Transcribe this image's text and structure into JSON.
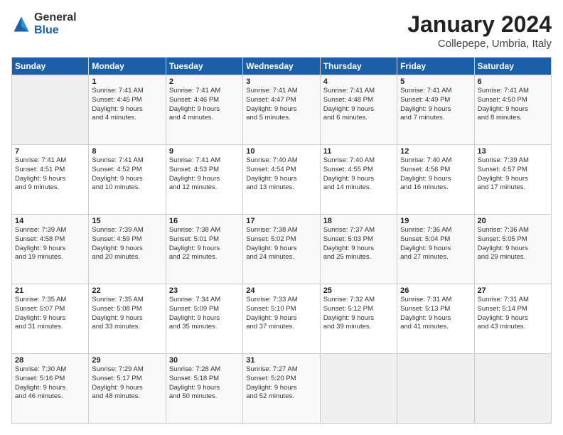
{
  "logo": {
    "general": "General",
    "blue": "Blue"
  },
  "title": "January 2024",
  "location": "Collepepe, Umbria, Italy",
  "weekdays": [
    "Sunday",
    "Monday",
    "Tuesday",
    "Wednesday",
    "Thursday",
    "Friday",
    "Saturday"
  ],
  "weeks": [
    [
      {
        "day": "",
        "info": ""
      },
      {
        "day": "1",
        "info": "Sunrise: 7:41 AM\nSunset: 4:45 PM\nDaylight: 9 hours\nand 4 minutes."
      },
      {
        "day": "2",
        "info": "Sunrise: 7:41 AM\nSunset: 4:46 PM\nDaylight: 9 hours\nand 4 minutes."
      },
      {
        "day": "3",
        "info": "Sunrise: 7:41 AM\nSunset: 4:47 PM\nDaylight: 9 hours\nand 5 minutes."
      },
      {
        "day": "4",
        "info": "Sunrise: 7:41 AM\nSunset: 4:48 PM\nDaylight: 9 hours\nand 6 minutes."
      },
      {
        "day": "5",
        "info": "Sunrise: 7:41 AM\nSunset: 4:49 PM\nDaylight: 9 hours\nand 7 minutes."
      },
      {
        "day": "6",
        "info": "Sunrise: 7:41 AM\nSunset: 4:50 PM\nDaylight: 9 hours\nand 8 minutes."
      }
    ],
    [
      {
        "day": "7",
        "info": "Sunrise: 7:41 AM\nSunset: 4:51 PM\nDaylight: 9 hours\nand 9 minutes."
      },
      {
        "day": "8",
        "info": "Sunrise: 7:41 AM\nSunset: 4:52 PM\nDaylight: 9 hours\nand 10 minutes."
      },
      {
        "day": "9",
        "info": "Sunrise: 7:41 AM\nSunset: 4:53 PM\nDaylight: 9 hours\nand 12 minutes."
      },
      {
        "day": "10",
        "info": "Sunrise: 7:40 AM\nSunset: 4:54 PM\nDaylight: 9 hours\nand 13 minutes."
      },
      {
        "day": "11",
        "info": "Sunrise: 7:40 AM\nSunset: 4:55 PM\nDaylight: 9 hours\nand 14 minutes."
      },
      {
        "day": "12",
        "info": "Sunrise: 7:40 AM\nSunset: 4:56 PM\nDaylight: 9 hours\nand 16 minutes."
      },
      {
        "day": "13",
        "info": "Sunrise: 7:39 AM\nSunset: 4:57 PM\nDaylight: 9 hours\nand 17 minutes."
      }
    ],
    [
      {
        "day": "14",
        "info": "Sunrise: 7:39 AM\nSunset: 4:58 PM\nDaylight: 9 hours\nand 19 minutes."
      },
      {
        "day": "15",
        "info": "Sunrise: 7:39 AM\nSunset: 4:59 PM\nDaylight: 9 hours\nand 20 minutes."
      },
      {
        "day": "16",
        "info": "Sunrise: 7:38 AM\nSunset: 5:01 PM\nDaylight: 9 hours\nand 22 minutes."
      },
      {
        "day": "17",
        "info": "Sunrise: 7:38 AM\nSunset: 5:02 PM\nDaylight: 9 hours\nand 24 minutes."
      },
      {
        "day": "18",
        "info": "Sunrise: 7:37 AM\nSunset: 5:03 PM\nDaylight: 9 hours\nand 25 minutes."
      },
      {
        "day": "19",
        "info": "Sunrise: 7:36 AM\nSunset: 5:04 PM\nDaylight: 9 hours\nand 27 minutes."
      },
      {
        "day": "20",
        "info": "Sunrise: 7:36 AM\nSunset: 5:05 PM\nDaylight: 9 hours\nand 29 minutes."
      }
    ],
    [
      {
        "day": "21",
        "info": "Sunrise: 7:35 AM\nSunset: 5:07 PM\nDaylight: 9 hours\nand 31 minutes."
      },
      {
        "day": "22",
        "info": "Sunrise: 7:35 AM\nSunset: 5:08 PM\nDaylight: 9 hours\nand 33 minutes."
      },
      {
        "day": "23",
        "info": "Sunrise: 7:34 AM\nSunset: 5:09 PM\nDaylight: 9 hours\nand 35 minutes."
      },
      {
        "day": "24",
        "info": "Sunrise: 7:33 AM\nSunset: 5:10 PM\nDaylight: 9 hours\nand 37 minutes."
      },
      {
        "day": "25",
        "info": "Sunrise: 7:32 AM\nSunset: 5:12 PM\nDaylight: 9 hours\nand 39 minutes."
      },
      {
        "day": "26",
        "info": "Sunrise: 7:31 AM\nSunset: 5:13 PM\nDaylight: 9 hours\nand 41 minutes."
      },
      {
        "day": "27",
        "info": "Sunrise: 7:31 AM\nSunset: 5:14 PM\nDaylight: 9 hours\nand 43 minutes."
      }
    ],
    [
      {
        "day": "28",
        "info": "Sunrise: 7:30 AM\nSunset: 5:16 PM\nDaylight: 9 hours\nand 46 minutes."
      },
      {
        "day": "29",
        "info": "Sunrise: 7:29 AM\nSunset: 5:17 PM\nDaylight: 9 hours\nand 48 minutes."
      },
      {
        "day": "30",
        "info": "Sunrise: 7:28 AM\nSunset: 5:18 PM\nDaylight: 9 hours\nand 50 minutes."
      },
      {
        "day": "31",
        "info": "Sunrise: 7:27 AM\nSunset: 5:20 PM\nDaylight: 9 hours\nand 52 minutes."
      },
      {
        "day": "",
        "info": ""
      },
      {
        "day": "",
        "info": ""
      },
      {
        "day": "",
        "info": ""
      }
    ]
  ]
}
